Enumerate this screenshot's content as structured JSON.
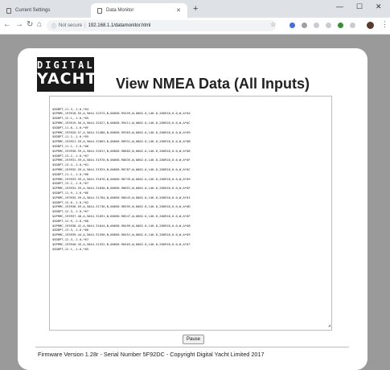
{
  "browser": {
    "tabs": [
      {
        "label": "Current Settings",
        "active": false
      },
      {
        "label": "Data Monitor",
        "active": true
      }
    ],
    "not_secure": "Not secure",
    "url": "192.168.1.1/datamonitor.html"
  },
  "page": {
    "logo_line1": "DIGITAL",
    "logo_line2": "YACHT",
    "title": "View NMEA Data (All Inputs)",
    "nmea_lines": [
      "$SDDPT,11.3,-1.0,*64",
      "$GPRMC,193918.55,A,5044.32574,N,00058.99459,W,0002.0,146.8,280918,0.0,W,A*04",
      "$SDDPT,12.1,-1.0,*65",
      "$GPRMC,193919.56,A,5044.32527,N,00058.99411,W,0002.0,146.8,280918,0.0,W,A*0C",
      "$SDDPT,11.8,-1.0,*6F",
      "$GPRMC,193920.57,A,5044.32480,N,00058.99363,W,0002.0,146.8,280918,0.0,W,A*09",
      "$SDDPT,11.2,-1.0,*65",
      "$GPRMC,193921.59,A,5044.32063,N,00058.98931,W,0002.0,146.8,280918,0.0,W,A*0B",
      "$SDDPT,11.1,-1.0,*66",
      "$GPRMC,193930.59,A,5044.32017,N,00058.98883,W,0002.0,146.8,280918,0.0,W,A*08",
      "$SDDPT,13.2,-1.0,*67",
      "$GPRMC,193931.59,A,5044.31970,N,00058.98835,W,0002.0,146.8,280918,0.0,W,A*0F",
      "$SDDPT,13.4,-1.0,*61",
      "$GPRMC,193932.59,A,5044.31923,N,00058.98787,W,0002.0,146.8,280918,0.0,W,A*0C",
      "$SDDPT,11.1,-1.0,*66",
      "$GPRMC,193933.59,A,5044.31876,N,00058.98739,W,0002.0,146.8,280918,0.0,W,A*09",
      "$SDDPT,13.2,-1.0,*67",
      "$GPRMC,193934.59,A,5044.31830,N,00058.98691,W,0002.0,146.8,280918,0.0,W,A*0F",
      "$SDDPT,11.9,-1.0,*6E",
      "$GPRMC,193935.59,A,5044.31784,N,00058.98643,W,0002.0,146.8,280918,0.0,W,A*01",
      "$SDDPT,12.6,-1.0,*62",
      "$GPRMC,193936.59,A,5044.31736,N,00058.98595,W,0002.0,146.8,280918,0.0,W,A*0D",
      "$SDDPT,12.3,-1.0,*67",
      "$GPRMC,193937.40,A,5044.31691,N,00058.98547,W,0002.0,146.8,280918,0.0,W,A*0F",
      "$SDDPT,12.9,-1.0,*6D",
      "$GPRMC,193938.42,A,5044.31644,N,00058.98499,W,0002.0,146.8,280918,0.0,W,A*08",
      "$SDDPT,13.3,-1.0,*66",
      "$GPRMC,193939.44,A,5044.31598,N,00058.98451,W,0002.0,146.8,280918,0.0,W,A*09",
      "$SDDPT,12.3,-1.0,*67",
      "$GPRMC,193940.45,A,5044.31552,N,00058.98403,W,0002.0,146.8,280918,0.0,W,A*07",
      "$SDDPT,12.1,-1.0,*65"
    ],
    "pause_label": "Pause",
    "footer": "Firmware Version 1.28r - Serial Number 5F92DC - Copyright Digital Yacht Limited 2017"
  },
  "colors": {
    "page_bg": "#9a9a9a",
    "card_bg": "#ffffff",
    "logo_bg": "#1a1a1a"
  }
}
